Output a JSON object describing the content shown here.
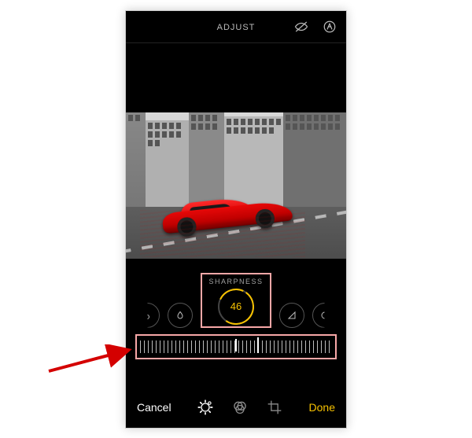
{
  "header": {
    "title": "ADJUST"
  },
  "adjustment": {
    "name_label": "SHARPNESS",
    "value": "46"
  },
  "bottombar": {
    "cancel_label": "Cancel",
    "done_label": "Done"
  }
}
